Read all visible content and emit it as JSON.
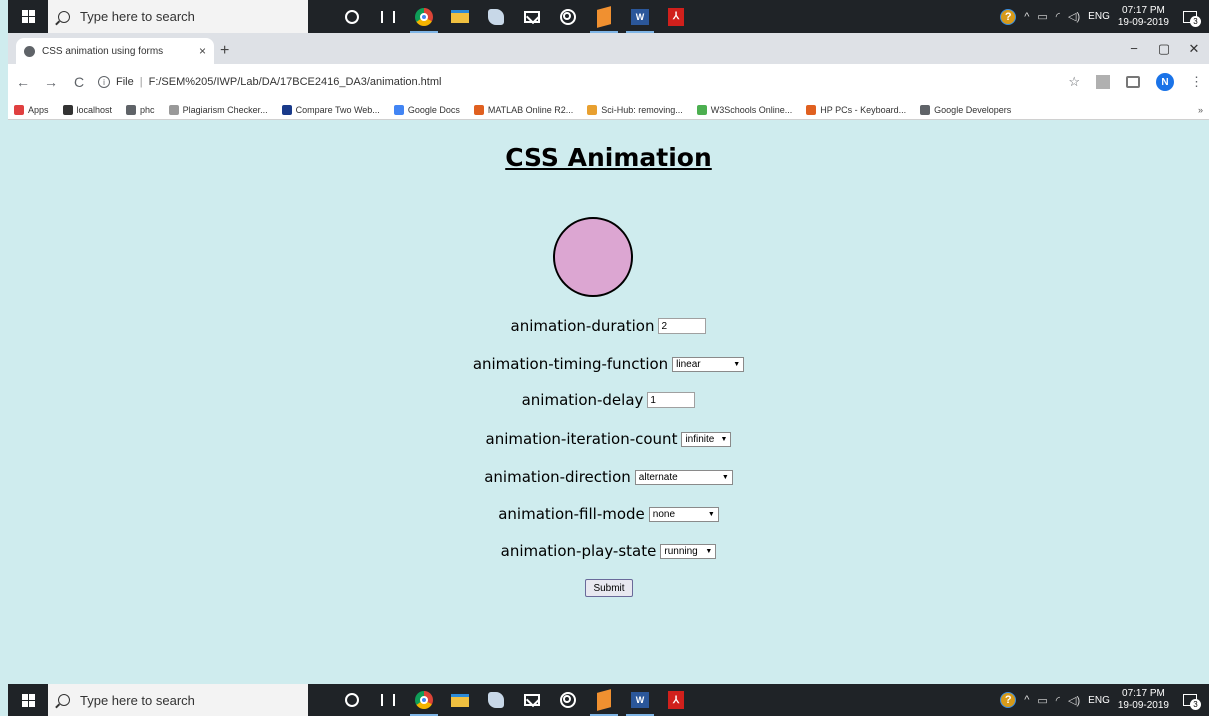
{
  "taskbar": {
    "search_placeholder": "Type here to search",
    "tray": {
      "help": "?",
      "caret": "^",
      "language": "ENG",
      "time": "07:17 PM",
      "date": "19-09-2019",
      "notifications": "3"
    }
  },
  "browser": {
    "tab_title": "CSS animation using forms",
    "tab_close": "×",
    "new_tab": "+",
    "window_controls": {
      "minimize": "−",
      "maximize": "▢",
      "close": "✕"
    },
    "nav": {
      "back": "←",
      "forward": "→",
      "reload": "C"
    },
    "url_scheme": "File",
    "url": "F:/SEM%205/IWP/Lab/DA/17BCE2416_DA3/animation.html",
    "star": "☆",
    "profile_initial": "N",
    "menu": "⋮",
    "bookmarks": [
      {
        "label": "Apps",
        "color": "#e04040"
      },
      {
        "label": "localhost",
        "color": "#333333"
      },
      {
        "label": "phc",
        "color": "#5f6368"
      },
      {
        "label": "Plagiarism Checker...",
        "color": "#999999"
      },
      {
        "label": "Compare Two Web...",
        "color": "#1a3a8a"
      },
      {
        "label": "Google Docs",
        "color": "#4285f4"
      },
      {
        "label": "MATLAB Online R2...",
        "color": "#e06020"
      },
      {
        "label": "Sci-Hub: removing...",
        "color": "#e8a030"
      },
      {
        "label": "W3Schools Online...",
        "color": "#4caf50"
      },
      {
        "label": "HP PCs - Keyboard...",
        "color": "#e06020"
      },
      {
        "label": "Google Developers",
        "color": "#5f6368"
      }
    ],
    "bookmarks_more": "»"
  },
  "page": {
    "title": "CSS Animation",
    "ball_color": "#dca6d2",
    "form": {
      "duration": {
        "label": "animation-duration",
        "value": "2"
      },
      "timing": {
        "label": "animation-timing-function",
        "value": "linear"
      },
      "delay": {
        "label": "animation-delay",
        "value": "1"
      },
      "iteration": {
        "label": "animation-iteration-count",
        "value": "infinite"
      },
      "direction": {
        "label": "animation-direction",
        "value": "alternate"
      },
      "fill": {
        "label": "animation-fill-mode",
        "value": "none"
      },
      "play": {
        "label": "animation-play-state",
        "value": "running"
      },
      "submit": "Submit"
    }
  }
}
